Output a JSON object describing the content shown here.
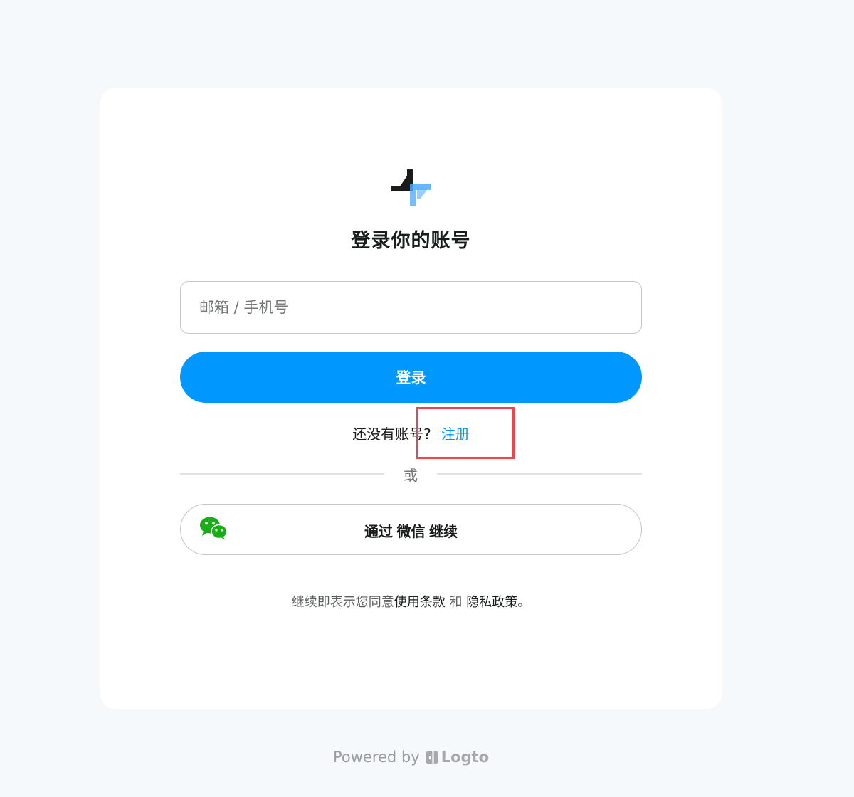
{
  "page": {
    "title": "登录你的账号"
  },
  "form": {
    "identifier_placeholder": "邮箱 / 手机号",
    "submit_label": "登录"
  },
  "register": {
    "prompt": "还没有账号?",
    "link_label": "注册"
  },
  "divider": {
    "label": "或"
  },
  "social": {
    "wechat_label": "通过 微信 继续",
    "icon": "wechat-icon"
  },
  "terms": {
    "prefix": "继续即表示您同意",
    "terms_link": "使用条款",
    "conjunction": "和",
    "privacy_link": "隐私政策",
    "suffix": "。"
  },
  "footer": {
    "powered_by": "Powered by",
    "brand": "Logto"
  },
  "colors": {
    "primary": "#0097ff",
    "background": "#f5f9fc",
    "card": "#ffffff",
    "highlight": "#f0434b",
    "wechat": "#1aad19"
  }
}
